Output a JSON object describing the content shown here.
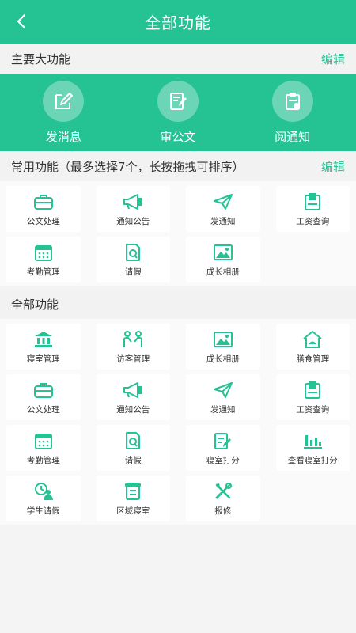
{
  "header": {
    "title": "全部功能",
    "back_icon": "chevron-left-icon"
  },
  "main_section": {
    "title": "主要大功能",
    "edit_label": "编辑",
    "items": [
      {
        "label": "发消息",
        "icon": "edit-message-icon"
      },
      {
        "label": "审公文",
        "icon": "review-doc-icon"
      },
      {
        "label": "阅通知",
        "icon": "read-notice-icon"
      }
    ]
  },
  "common_section": {
    "title": "常用功能（最多选择7个，长按拖拽可排序）",
    "edit_label": "编辑",
    "items": [
      {
        "label": "公文处理",
        "icon": "briefcase-icon"
      },
      {
        "label": "通知公告",
        "icon": "megaphone-icon"
      },
      {
        "label": "发通知",
        "icon": "paper-plane-icon"
      },
      {
        "label": "工资查询",
        "icon": "payslip-icon"
      },
      {
        "label": "考勤管理",
        "icon": "calendar-icon"
      },
      {
        "label": "请假",
        "icon": "leave-doc-icon"
      },
      {
        "label": "成长相册",
        "icon": "photo-album-icon"
      }
    ]
  },
  "all_section": {
    "title": "全部功能",
    "items": [
      {
        "label": "寝室管理",
        "icon": "building-icon"
      },
      {
        "label": "访客管理",
        "icon": "visitors-icon"
      },
      {
        "label": "成长相册",
        "icon": "photo-album-icon"
      },
      {
        "label": "膳食管理",
        "icon": "meal-house-icon"
      },
      {
        "label": "公文处理",
        "icon": "briefcase-icon"
      },
      {
        "label": "通知公告",
        "icon": "megaphone-icon"
      },
      {
        "label": "发通知",
        "icon": "paper-plane-icon"
      },
      {
        "label": "工资查询",
        "icon": "payslip-icon"
      },
      {
        "label": "考勤管理",
        "icon": "calendar-icon"
      },
      {
        "label": "请假",
        "icon": "leave-doc-icon"
      },
      {
        "label": "寝室打分",
        "icon": "score-pen-icon"
      },
      {
        "label": "查看寝室打分",
        "icon": "bar-chart-icon"
      },
      {
        "label": "学生请假",
        "icon": "student-clock-icon"
      },
      {
        "label": "区域寝室",
        "icon": "scroll-doc-icon"
      },
      {
        "label": "报修",
        "icon": "repair-tools-icon"
      }
    ]
  },
  "colors": {
    "accent": "#25c293",
    "background": "#f4f4f4"
  }
}
